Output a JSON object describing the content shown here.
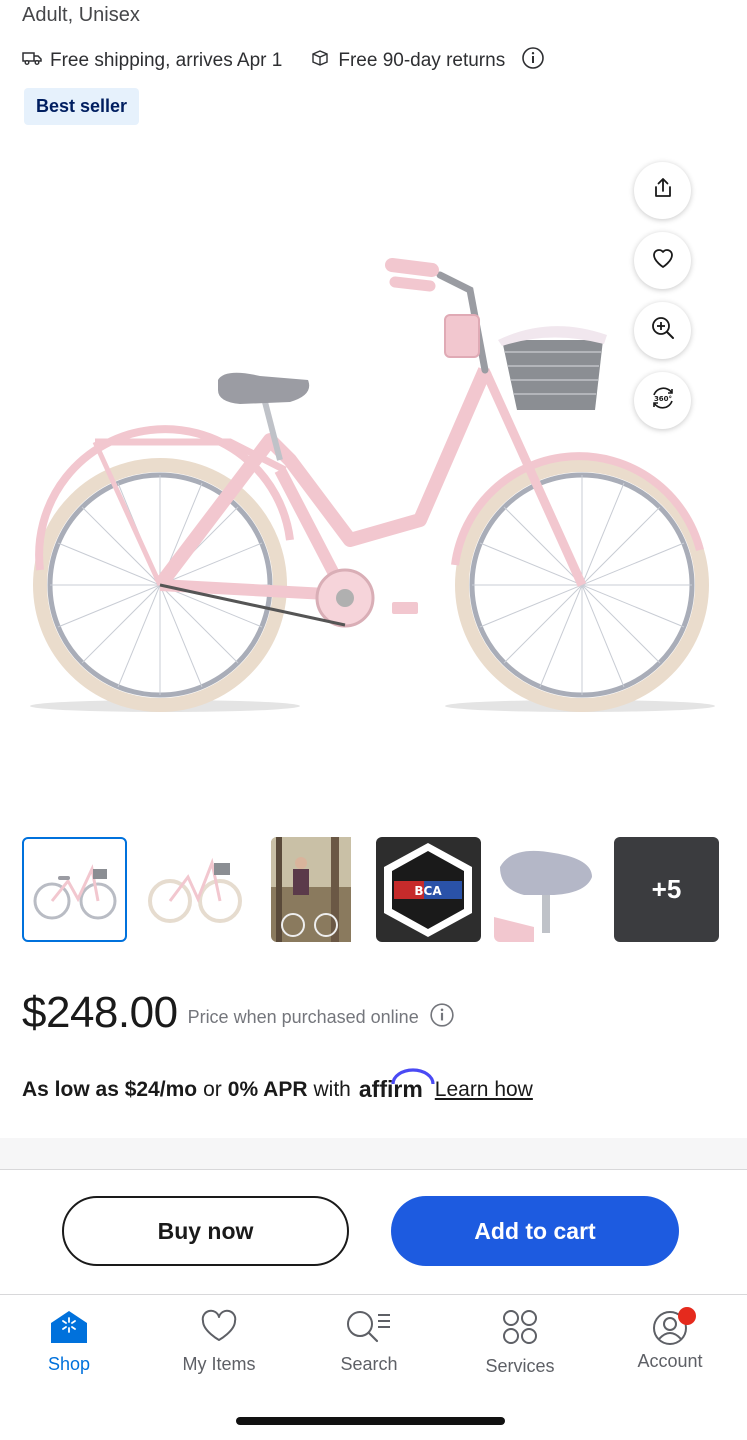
{
  "product": {
    "subtitle": "Adult, Unisex",
    "shipping_text": "Free shipping, arrives Apr 1",
    "returns_text": "Free 90-day returns",
    "badge": "Best seller",
    "thumb_more": "+5"
  },
  "price": {
    "amount": "$248.00",
    "note": "Price when purchased online"
  },
  "financing": {
    "as_low_as": "As low as $24/mo",
    "or": "or",
    "apr": "0% APR",
    "with": "with",
    "brand": "affirm",
    "learn": "Learn how"
  },
  "actions": {
    "buy_now": "Buy now",
    "add_to_cart": "Add to cart"
  },
  "tabs": [
    {
      "label": "Shop",
      "icon": "shop-icon",
      "active": true
    },
    {
      "label": "My Items",
      "icon": "heart-icon",
      "active": false
    },
    {
      "label": "Search",
      "icon": "search-list-icon",
      "active": false
    },
    {
      "label": "Services",
      "icon": "services-grid-icon",
      "active": false
    },
    {
      "label": "Account",
      "icon": "account-icon",
      "active": false
    }
  ],
  "colors": {
    "accent_blue": "#1d5be0",
    "active_tab": "#0071dc",
    "badge_bg": "#e6f1fc",
    "badge_text": "#001e60",
    "notification_dot": "#e52a1d",
    "bike_pink": "#f2c7cf"
  }
}
